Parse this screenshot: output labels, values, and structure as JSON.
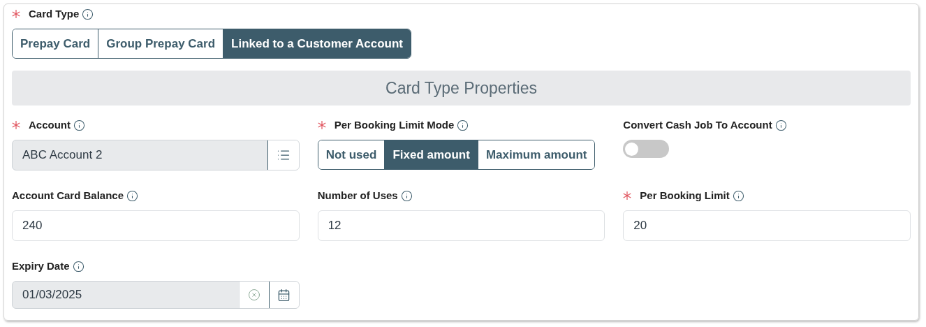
{
  "card_type": {
    "label": "Card Type",
    "required": true,
    "segments": [
      {
        "label": "Prepay Card",
        "selected": false
      },
      {
        "label": "Group Prepay Card",
        "selected": false
      },
      {
        "label": "Linked to a Customer Account",
        "selected": true
      }
    ]
  },
  "section_title": "Card Type Properties",
  "fields": [
    {
      "kind": "lookup",
      "label": "Account",
      "required": true,
      "value": "ABC Account 2",
      "disabled": true
    },
    {
      "kind": "segmented",
      "label": "Per Booking Limit Mode",
      "required": true,
      "segments": [
        {
          "label": "Not used",
          "selected": false
        },
        {
          "label": "Fixed amount",
          "selected": true
        },
        {
          "label": "Maximum amount",
          "selected": false
        }
      ]
    },
    {
      "kind": "toggle",
      "label": "Convert Cash Job To Account",
      "required": false,
      "on": false
    },
    {
      "kind": "input",
      "label": "Account Card Balance",
      "required": false,
      "value": "240",
      "disabled": false
    },
    {
      "kind": "input",
      "label": "Number of Uses",
      "required": false,
      "value": "12",
      "disabled": false
    },
    {
      "kind": "input",
      "label": "Per Booking Limit",
      "required": true,
      "value": "20",
      "disabled": false
    },
    {
      "kind": "date",
      "label": "Expiry Date",
      "required": false,
      "value": "01/03/2025",
      "disabled": true
    }
  ]
}
